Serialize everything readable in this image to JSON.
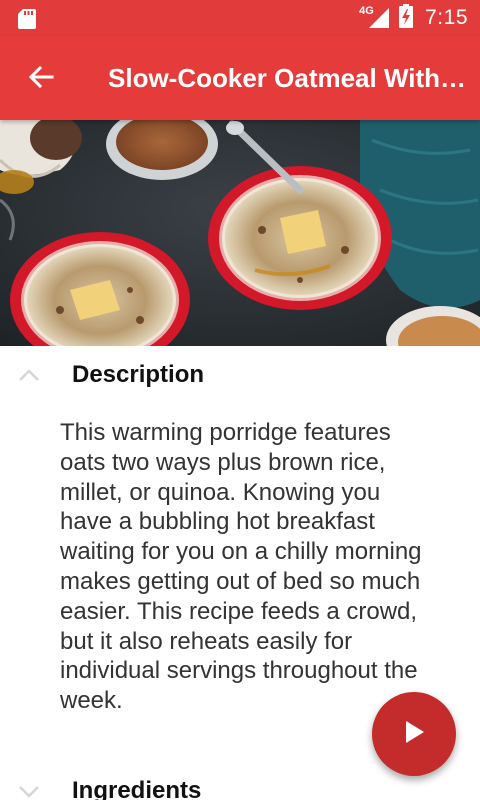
{
  "status_bar": {
    "network": "4G",
    "time": "7:15"
  },
  "app_bar": {
    "title": "Slow-Cooker Oatmeal With Steel-Cut Oats and Brown Rice",
    "back_icon": "arrow-back-icon"
  },
  "hero": {
    "image_alt": "recipe-photo"
  },
  "description": {
    "heading": "Description",
    "body": "This warming porridge features oats two ways plus brown rice, millet, or quinoa. Knowing you have a bubbling hot breakfast waiting for you on a chilly morning makes getting out of bed so much easier. This recipe feeds a crowd, but it also reheats easily for individual servings throughout the week.",
    "expanded": true,
    "toggle_icon": "chevron-up-icon"
  },
  "ingredients": {
    "heading": "Ingredients",
    "expanded": false,
    "toggle_icon": "chevron-down-icon"
  },
  "fab": {
    "icon": "play-icon"
  },
  "colors": {
    "status_bar": "#e23b3b",
    "app_bar": "#e53b3b",
    "fab": "#c42b2b"
  }
}
